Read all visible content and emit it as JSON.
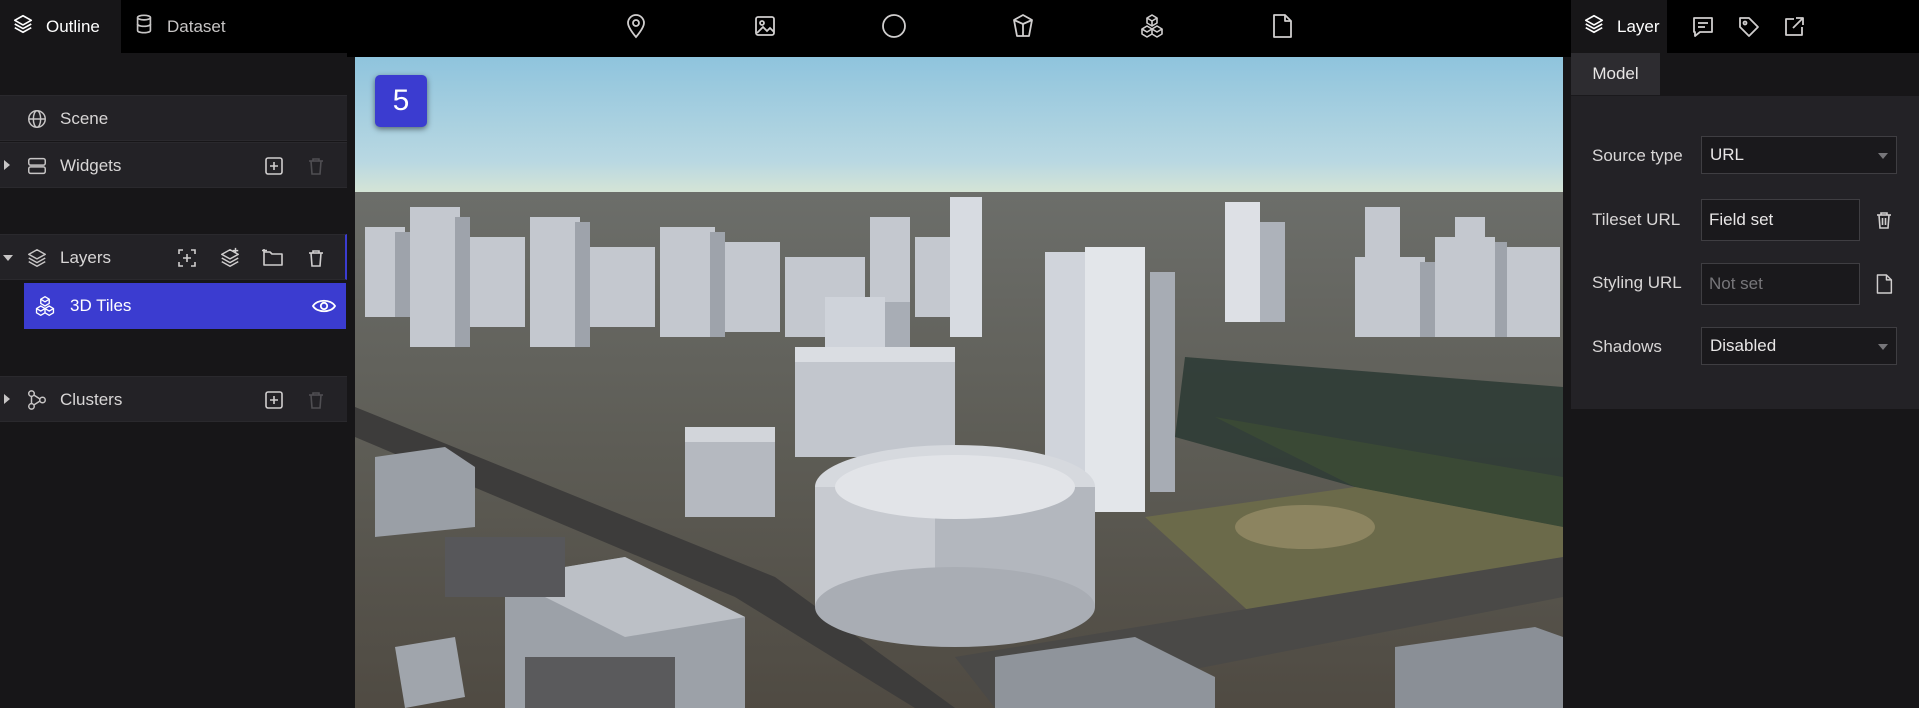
{
  "header": {
    "left_tabs": [
      {
        "label": "Outline",
        "icon": "layers-icon",
        "active": true
      },
      {
        "label": "Dataset",
        "icon": "database-icon",
        "active": false
      }
    ],
    "tools": [
      "map-pin-icon",
      "image-icon",
      "circle-icon",
      "box-icon",
      "cubes-icon",
      "file-icon"
    ],
    "right_tabs": [
      {
        "label": "Layer",
        "icon": "layers-icon",
        "active": true
      }
    ],
    "right_icons": [
      "comment-icon",
      "tag-icon",
      "export-icon"
    ]
  },
  "outline": {
    "scene": {
      "label": "Scene",
      "icon": "globe-icon"
    },
    "widgets": {
      "label": "Widgets",
      "icon": "widgets-icon"
    },
    "layers": {
      "label": "Layers",
      "icon": "layers-icon"
    },
    "selected_layer": {
      "label": "3D Tiles",
      "icon": "cubes-icon",
      "visible": true
    },
    "clusters": {
      "label": "Clusters",
      "icon": "clusters-icon"
    }
  },
  "viewport": {
    "step_badge": "5"
  },
  "inspector": {
    "tab": "Model",
    "fields": {
      "source_type": {
        "label": "Source type",
        "value": "URL"
      },
      "tileset_url": {
        "label": "Tileset URL",
        "value": "Field set"
      },
      "styling_url": {
        "label": "Styling URL",
        "placeholder": "Not set"
      },
      "shadows": {
        "label": "Shadows",
        "value": "Disabled"
      }
    }
  },
  "colors": {
    "accent": "#3b3cd0",
    "panel": "#232226",
    "background": "#171618",
    "topbar": "#000000"
  }
}
